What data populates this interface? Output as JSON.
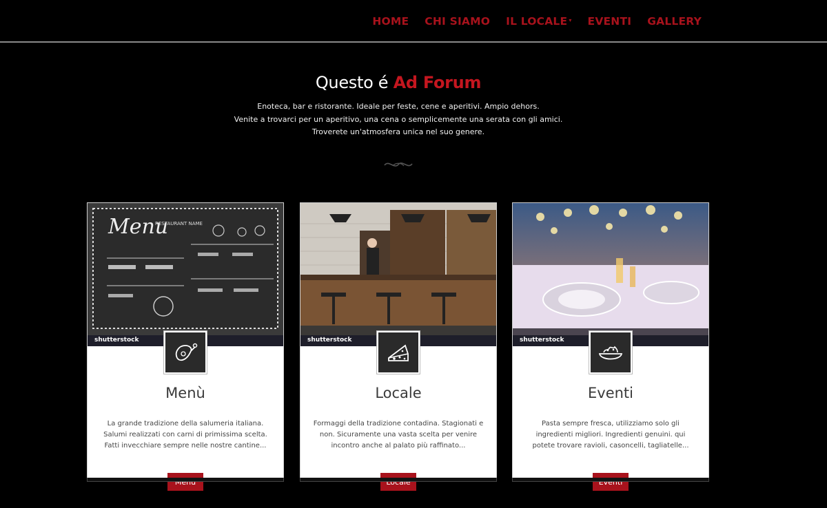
{
  "nav": {
    "items": [
      {
        "label": "HOME"
      },
      {
        "label": "CHI SIAMO"
      },
      {
        "label": "IL LOCALE"
      },
      {
        "label": "EVENTI"
      },
      {
        "label": "GALLERY"
      }
    ],
    "caret": "▾"
  },
  "hero": {
    "title_prefix": "Questo é ",
    "title_brand": "Ad Forum",
    "lines": [
      "Enoteca, bar e ristorante. Ideale per feste, cene e aperitivi. Ampio dehors.",
      "Venite a trovarci per un aperitivo, una cena o semplicemente una serata con gli amici.",
      "Troverete un'atmosfera unica nel suo genere."
    ]
  },
  "cards": [
    {
      "icon": "ham-leg-icon",
      "watermark": "shutterstock",
      "title": "Menù",
      "text": "La grande tradizione della salumeria italiana. Salumi realizzati con carni di primissima scelta. Fatti invecchiare sempre nelle nostre cantine...",
      "button": "Menù",
      "chalk_title": "Menu",
      "chalk_subtitle": "RESTAURANT NAME"
    },
    {
      "icon": "cheese-icon",
      "watermark": "shutterstock",
      "title": "Locale",
      "text": "Formaggi della tradizione contadina. Stagionati e non. Sicuramente una vasta scelta per venire incontro anche al palato più raffinato...",
      "button": "Locale"
    },
    {
      "icon": "pasta-bowl-icon",
      "watermark": "shutterstock",
      "title": "Eventi",
      "text": "Pasta sempre fresca, utilizziamo solo gli ingredienti migliori. Ingredienti genuini. qui potete trovare ravioli, casoncelli, tagliatelle...",
      "button": "Eventi"
    }
  ],
  "colors": {
    "accent": "#a8121c",
    "brand_red": "#c4161f",
    "background": "#000000",
    "card_bg": "#ffffff"
  }
}
